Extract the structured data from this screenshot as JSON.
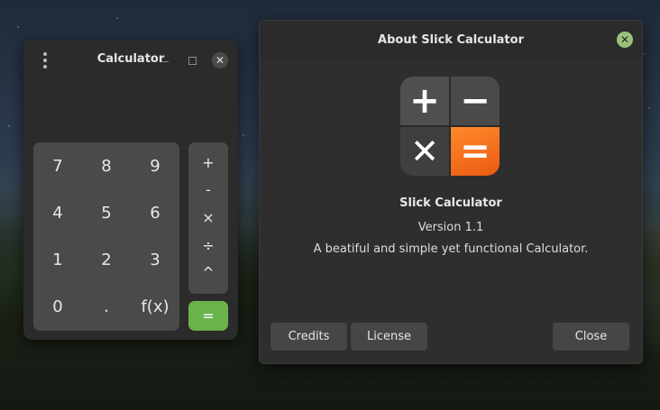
{
  "calculator": {
    "title": "Calculator",
    "close_glyph": "✕",
    "number_keys": [
      "7",
      "8",
      "9",
      "4",
      "5",
      "6",
      "1",
      "2",
      "3",
      "0",
      ".",
      "f(x)"
    ],
    "operator_keys": [
      "+",
      "-",
      "×",
      "÷",
      "^"
    ],
    "equals": "="
  },
  "about": {
    "title": "About Slick Calculator",
    "close_glyph": "✕",
    "icon": {
      "plus": "+",
      "minus": "−",
      "times": "✕",
      "equals": "="
    },
    "app_name": "Slick Calculator",
    "version": "Version 1.1",
    "description": "A beatiful and simple yet functional Calculator.",
    "buttons": {
      "credits": "Credits",
      "license": "License",
      "close": "Close"
    }
  },
  "colors": {
    "equals_green": "#6ab24a",
    "dialog_close_green": "#9ac27a",
    "icon_orange": "#f2711c"
  }
}
